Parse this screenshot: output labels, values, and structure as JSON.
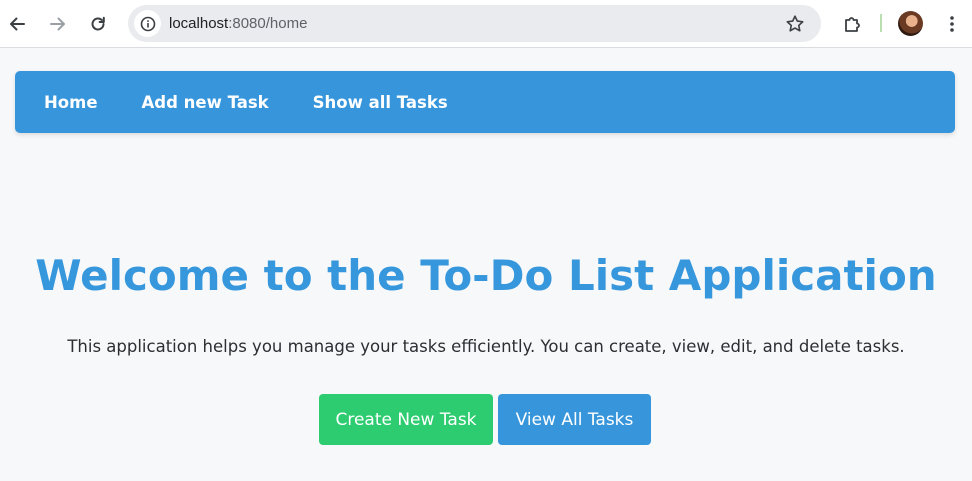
{
  "browser": {
    "url_host": "localhost",
    "url_path": ":8080/home",
    "icons": {
      "back": "arrow-left-icon",
      "forward": "arrow-right-icon",
      "reload": "reload-icon",
      "site_info": "info-icon",
      "bookmark": "star-icon",
      "extensions": "puzzle-icon",
      "profile": "avatar",
      "menu": "kebab-menu-icon"
    }
  },
  "nav": {
    "items": [
      {
        "label": "Home"
      },
      {
        "label": "Add new Task"
      },
      {
        "label": "Show all Tasks"
      }
    ]
  },
  "main": {
    "title": "Welcome to the To-Do List Application",
    "description": "This application helps you manage your tasks efficiently. You can create, view, edit, and delete tasks.",
    "buttons": {
      "create": "Create New Task",
      "view_all": "View All Tasks"
    }
  },
  "colors": {
    "nav_bg": "#3796db",
    "title": "#3797dc",
    "create_button": "#2ecc71",
    "view_button": "#3796db",
    "page_bg": "#f7f8fa"
  }
}
